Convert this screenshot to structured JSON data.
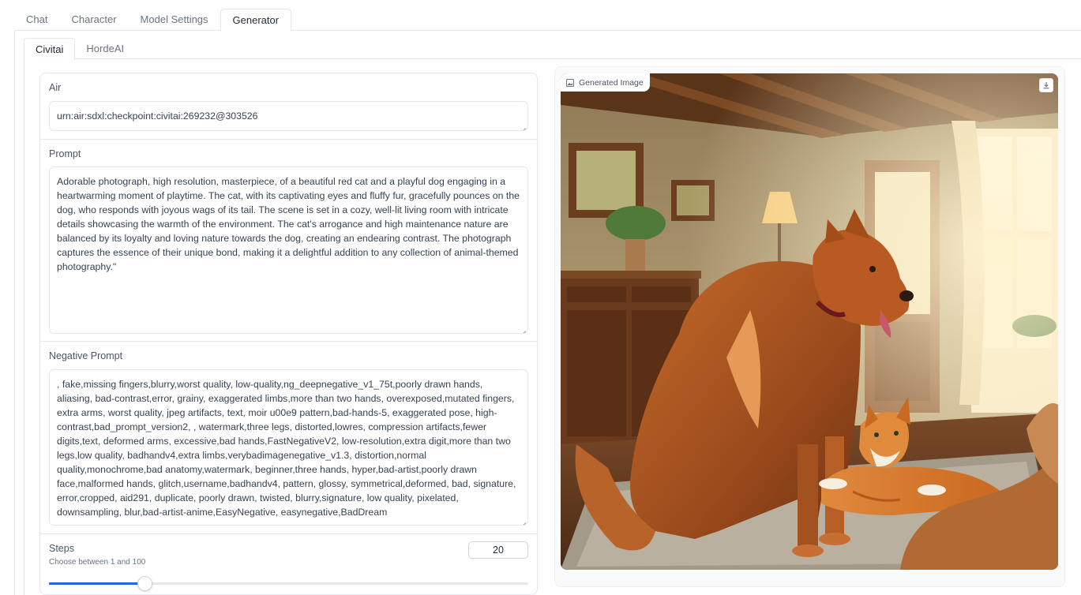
{
  "top_tabs": [
    "Chat",
    "Character",
    "Model Settings",
    "Generator"
  ],
  "active_top_tab": "Generator",
  "sub_tabs": [
    "Civitai",
    "HordeAI"
  ],
  "active_sub_tab": "Civitai",
  "air": {
    "label": "Air",
    "value": "urn:air:sdxl:checkpoint:civitai:269232@303526"
  },
  "prompt": {
    "label": "Prompt",
    "value": "Adorable photograph, high resolution, masterpiece, of a beautiful red cat and a playful dog engaging in a heartwarming moment of playtime. The cat, with its captivating eyes and fluffy fur, gracefully pounces on the dog, who responds with joyous wags of its tail. The scene is set in a cozy, well-lit living room with intricate details showcasing the warmth of the environment. The cat's arrogance and high maintenance nature are balanced by its loyalty and loving nature towards the dog, creating an endearing contrast. The photograph captures the essence of their unique bond, making it a delightful addition to any collection of animal-themed photography.\""
  },
  "negative_prompt": {
    "label": "Negative Prompt",
    "value": ", fake,missing fingers,blurry,worst quality, low-quality,ng_deepnegative_v1_75t,poorly drawn hands, aliasing, bad-contrast,error, grainy, exaggerated limbs,more than two hands, overexposed,mutated fingers, extra arms, worst quality, jpeg artifacts, text, moir u00e9 pattern,bad-hands-5, exaggerated pose, high-contrast,bad_prompt_version2, , watermark,three legs, distorted,lowres, compression artifacts,fewer digits,text, deformed arms, excessive,bad hands,FastNegativeV2, low-resolution,extra digit,more than two legs,low quality, badhandv4,extra limbs,verybadimagenegative_v1.3, distortion,normal quality,monochrome,bad anatomy,watermark, beginner,three hands, hyper,bad-artist,poorly drawn face,malformed hands, glitch,username,badhandv4, pattern, glossy, symmetrical,deformed, bad, signature, error,cropped, aid291, duplicate, poorly drawn, twisted, blurry,signature, low quality, pixelated, downsampling, blur,bad-artist-anime,EasyNegative, easynegative,BadDream"
  },
  "steps": {
    "label": "Steps",
    "hint": "Choose between 1 and 100",
    "value": "20",
    "min": 1,
    "max": 100,
    "fraction": 0.2
  },
  "output": {
    "label": "Generated Image",
    "image_icon": "image-icon",
    "download_icon": "download-icon"
  },
  "colors": {
    "accent": "#2563eb",
    "border": "#e5e7eb"
  }
}
